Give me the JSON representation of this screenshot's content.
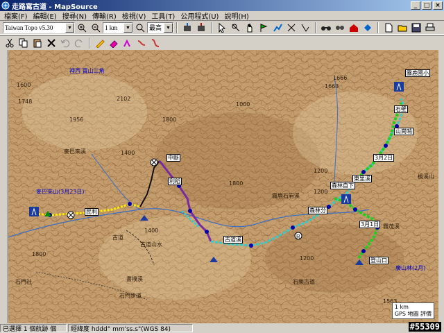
{
  "window": {
    "title": "走路寫古道 - MapSource"
  },
  "menu": [
    "檔案(F)",
    "編輯(E)",
    "搜尋(N)",
    "傳輸(R)",
    "檢視(V)",
    "工具(T)",
    "公用程式(U)",
    "說明(H)"
  ],
  "toolbar": {
    "map_product": "Taiwan Topo v5.30",
    "zoom": "1 km",
    "detail": "最高"
  },
  "map": {
    "peaks": [
      {
        "name": "裡西 寶山三角"
      },
      {
        "name": "麥巴來山(3月23日)"
      },
      {
        "name": "廣山林(2月)"
      }
    ],
    "elev_labels": [
      "1600",
      "2102",
      "1748",
      "1956",
      "1400",
      "1800",
      "1663",
      "1200",
      "1000",
      "1800",
      "1200",
      "1400",
      "1200",
      "1666",
      "1563",
      "1800"
    ],
    "place_labels": [
      "麥巴來溪",
      "古道",
      "石門步道",
      "石門社",
      "古道山水",
      "霧鹿石岩溪",
      "書樸溪",
      "石樂古道",
      "霧茂溪",
      "楓溪山"
    ],
    "waypoints": [
      "霧鹿國小",
      "石壁",
      "山崗哨",
      "3月2日",
      "東里溪",
      "森林自下",
      "3月1日",
      "森林分",
      "民利",
      "利稻",
      "古道溪",
      "中斷",
      "登山口"
    ],
    "scale_label": "1 km",
    "legend_label": "GPS 地圖 評價"
  },
  "status": {
    "selected": "已選擇 1 個航跡 個",
    "coords": "經緯度 hddd° mm'ss.s\"(WGS 84)"
  },
  "watermark": "#55309",
  "colors": {
    "terrain": "#c2996a",
    "contour": "#8a5a2a",
    "track_green": "#22cc22",
    "track_purple": "#7a2aa0",
    "track_cyan": "#33cccc",
    "track_yellow": "#ffee00"
  }
}
